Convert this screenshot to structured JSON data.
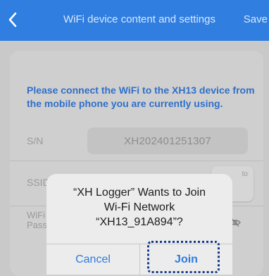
{
  "header": {
    "title": "WiFi device content and settings",
    "save_label": "Save",
    "back_icon": "chevron-left-icon"
  },
  "form": {
    "prompt": "Please connect the WiFi to the XH13 device from the mobile phone you are currently using.",
    "sn_label": "S/N",
    "sn_value": "XH202401251307",
    "ssid_label": "SSID",
    "password_label_line1": "WiFi",
    "password_label_line2": "Pass",
    "connect_button_fragment": "to",
    "password_visibility_icon": "eye-slash-icon"
  },
  "dialog": {
    "title_line1": "“XH Logger” Wants to Join",
    "title_line2": "Wi-Fi Network",
    "title_line3": "“XH13_91A894”?",
    "cancel_label": "Cancel",
    "join_label": "Join"
  },
  "colors": {
    "header_bg": "#2f7ee0",
    "accent_blue": "#2d7be0",
    "highlight_border": "#123a8a"
  }
}
